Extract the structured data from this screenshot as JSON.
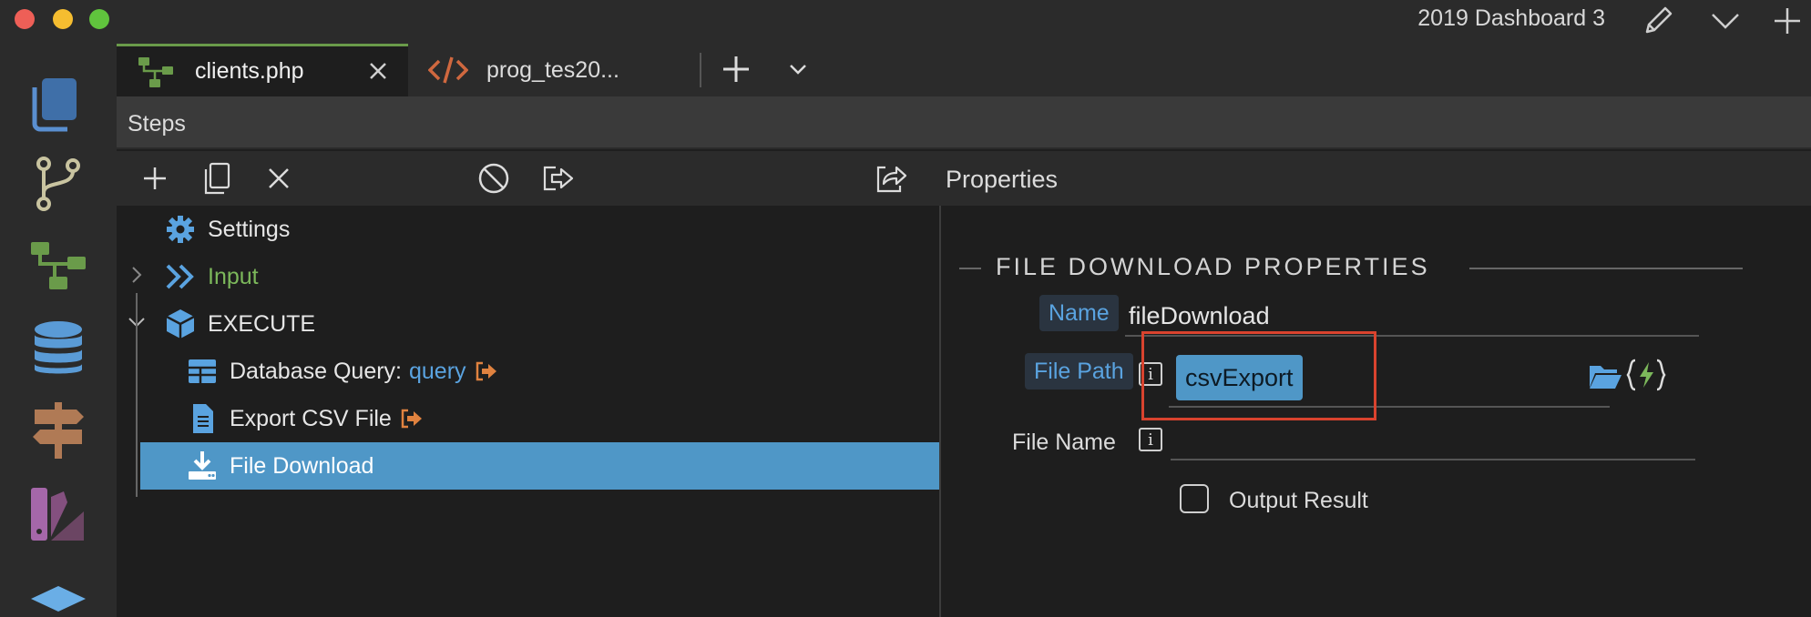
{
  "window": {
    "title": "2019 Dashboard 3"
  },
  "tabs": [
    {
      "label": "clients.php",
      "active": true
    },
    {
      "label": "prog_tes20...",
      "active": false
    }
  ],
  "steps": {
    "title": "Steps"
  },
  "properties_panel": {
    "title": "Properties"
  },
  "tree": {
    "items": [
      {
        "label": "Settings"
      },
      {
        "label": "Input"
      },
      {
        "label": "EXECUTE"
      },
      {
        "label": "Database Query:",
        "suffix": "query"
      },
      {
        "label": "Export CSV File"
      },
      {
        "label": "File Download",
        "selected": true
      }
    ]
  },
  "form": {
    "section_title": "FILE DOWNLOAD PROPERTIES",
    "name_label": "Name",
    "name_value": "fileDownload",
    "file_path_label": "File Path",
    "file_path_token": "csvExport",
    "file_name_label": "File Name",
    "file_name_value": "",
    "info_glyph": "i",
    "output_result_label": "Output Result",
    "output_result_checked": false
  },
  "colors": {
    "accent_blue": "#4f97c7",
    "input_green": "#7cb85b",
    "highlight_red": "#d9432e",
    "tab_active_border": "#6a9b4a"
  }
}
